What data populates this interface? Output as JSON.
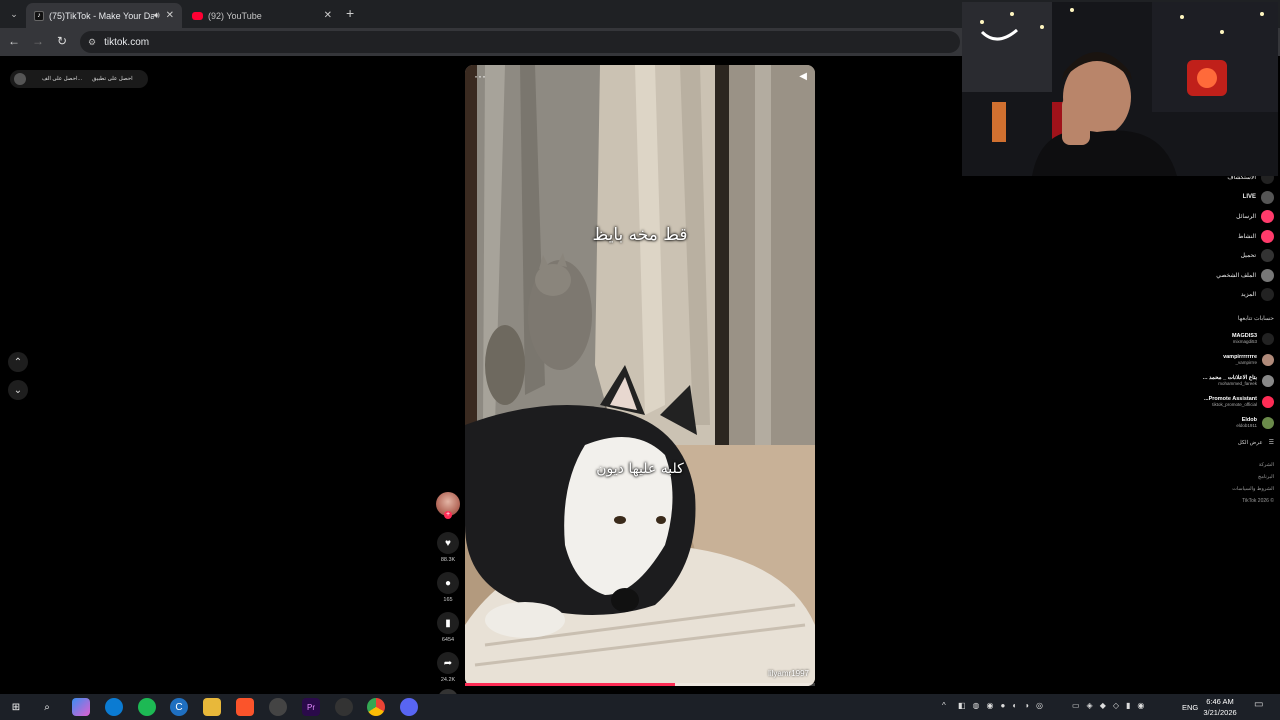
{
  "browser": {
    "tabs": [
      {
        "title": "(75)TikTok - Make Your Day",
        "active": true,
        "favicon": "tiktok-icon",
        "audio": true
      },
      {
        "title": "(92) YouTube",
        "active": false,
        "favicon": "youtube-icon"
      }
    ],
    "url": "tiktok.com"
  },
  "banner": {
    "get_app": "احصل على تطبيق",
    "get_coins": "احصل على الف..."
  },
  "video": {
    "caption_top": "قط مخه بايظ",
    "caption_mid": "كلبه عليها ديون",
    "watermark": "lilyamr1997",
    "progress_percent": 60
  },
  "actions": {
    "likes": "88.3K",
    "comments": "165",
    "saves": "6454",
    "shares": "24.2K"
  },
  "sidebar": {
    "nav": [
      {
        "label": "الاستكشاف",
        "icon": "compass-icon",
        "color": "#222"
      },
      {
        "label": "LIVE",
        "icon": "live-icon",
        "color": "#555",
        "bold": true
      },
      {
        "label": "الرسائل",
        "icon": "message-icon",
        "color": "#ff3b6b"
      },
      {
        "label": "النشاط",
        "icon": "activity-icon",
        "color": "#ff3b6b"
      },
      {
        "label": "تحميل",
        "icon": "upload-icon",
        "color": "#333"
      },
      {
        "label": "الملف الشخصي",
        "icon": "profile-icon",
        "color": "#777"
      },
      {
        "label": "المزيد",
        "icon": "more-icon",
        "color": "#222"
      }
    ],
    "following_heading": "حسابات تتابعها",
    "following": [
      {
        "name": "MAGDIS3",
        "handle": "mixmagdi53",
        "color": "#222"
      },
      {
        "name": "vampirrrrrrre",
        "handle": "vampirrre_",
        "color": "#b08a7a"
      },
      {
        "name": "بتاع الاعلانات _ محمد ...",
        "handle": "mohammed_fareek",
        "color": "#888"
      },
      {
        "name": "Promote Assistant...",
        "handle": "tiktok_promote_official",
        "color": "#fe2c55"
      },
      {
        "name": "Eldob",
        "handle": "eldob1911",
        "color": "#6a8a4a"
      }
    ],
    "see_all": "عرض الكل",
    "footer": [
      "الشركة",
      "البرنامج",
      "الشروط والسياسات",
      "© 2026 TikTok"
    ]
  },
  "taskbar": {
    "language": "ENG",
    "time": "6:46 AM",
    "date": "3/21/2026"
  }
}
